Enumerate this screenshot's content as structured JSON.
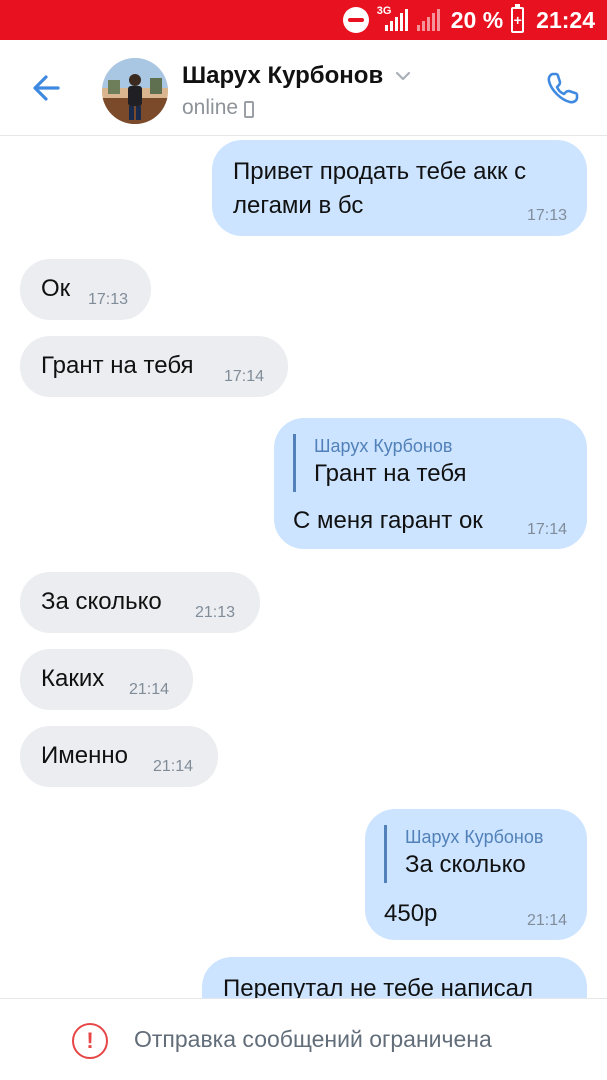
{
  "status_bar": {
    "network_label": "3G",
    "battery_percent": "20 %",
    "time": "21:24",
    "icons": [
      "do-not-disturb-icon",
      "signal-3g-icon",
      "signal-icon",
      "battery-charging-icon"
    ],
    "color": "#e8111f"
  },
  "header": {
    "contact_name": "Шарух Курбонов",
    "status": "online",
    "icons": [
      "back-arrow-icon",
      "avatar",
      "chevron-down-icon",
      "mobile-phone-icon",
      "phone-call-icon"
    ]
  },
  "messages": [
    {
      "direction": "out",
      "text_lines": [
        "Привет продать тебе акк с",
        "легами в бс"
      ],
      "time": "17:13"
    },
    {
      "direction": "in",
      "text": "Ок",
      "time": "17:13"
    },
    {
      "direction": "in",
      "text": "Грант на тебя",
      "time": "17:14"
    },
    {
      "direction": "out",
      "reply": {
        "author": "Шарух Курбонов",
        "text": "Грант на тебя"
      },
      "text": "С меня гарант ок",
      "time": "17:14"
    },
    {
      "direction": "in",
      "text": "За сколько",
      "time": "21:13"
    },
    {
      "direction": "in",
      "text": "Каких",
      "time": "21:14"
    },
    {
      "direction": "in",
      "text": "Именно",
      "time": "21:14"
    },
    {
      "direction": "out",
      "reply": {
        "author": "Шарух Курбонов",
        "text": "За сколько"
      },
      "text": "450р",
      "time": "21:14"
    },
    {
      "direction": "out",
      "text": "Перепутал не тебе написал",
      "time": ""
    }
  ],
  "bottom_bar": {
    "notice": "Отправка сообщений ограничена",
    "icon": "exclamation-circle-icon",
    "icon_glyph": "!"
  },
  "colors": {
    "outgoing_bubble": "#cce4ff",
    "incoming_bubble": "#ebedf0",
    "accent": "#5181b8",
    "warning": "#e64646"
  }
}
